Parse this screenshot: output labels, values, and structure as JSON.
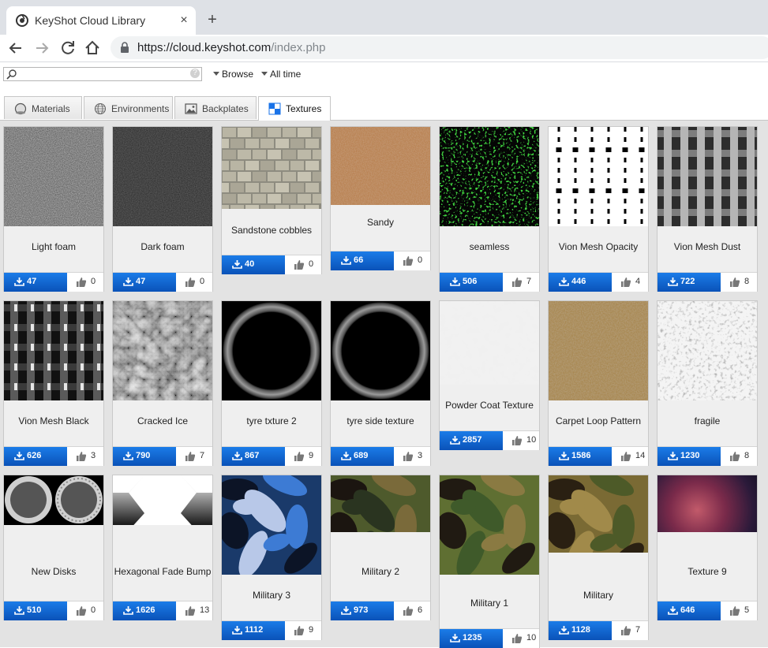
{
  "browser": {
    "tab_title": "KeyShot Cloud Library",
    "tab_close": "×",
    "new_tab": "+",
    "url_host": "https://cloud.keyshot.com",
    "url_path": "/index.php"
  },
  "filters": {
    "search_placeholder": "",
    "help": "?",
    "browse": "Browse",
    "time": "All time"
  },
  "tabs": [
    {
      "label": "Materials",
      "icon": "globe-outline-icon"
    },
    {
      "label": "Environments",
      "icon": "grid-globe-icon"
    },
    {
      "label": "Backplates",
      "icon": "image-icon"
    },
    {
      "label": "Textures",
      "icon": "checker-icon",
      "active": true
    }
  ],
  "colors": {
    "download_button": "#0a52b8",
    "accent": "#1b7ce8"
  },
  "items": [
    {
      "title": "Light foam",
      "downloads": "47",
      "likes": "0",
      "texture": "light-foam"
    },
    {
      "title": "Dark foam",
      "downloads": "47",
      "likes": "0",
      "texture": "dark-foam"
    },
    {
      "title": "Sandstone cobbles",
      "downloads": "40",
      "likes": "0",
      "texture": "sandstone"
    },
    {
      "title": "Sandy",
      "downloads": "66",
      "likes": "0",
      "texture": "sandy"
    },
    {
      "title": "seamless",
      "downloads": "506",
      "likes": "7",
      "texture": "green-speckle"
    },
    {
      "title": "Vion Mesh Opacity",
      "downloads": "446",
      "likes": "4",
      "texture": "mesh-opacity"
    },
    {
      "title": "Vion Mesh Dust",
      "downloads": "722",
      "likes": "8",
      "texture": "mesh-dust"
    },
    {
      "title": "Vion Mesh Black",
      "downloads": "626",
      "likes": "3",
      "texture": "mesh-black"
    },
    {
      "title": "Cracked Ice",
      "downloads": "790",
      "likes": "7",
      "texture": "cracked-ice"
    },
    {
      "title": "tyre txture 2",
      "downloads": "867",
      "likes": "9",
      "texture": "tyre"
    },
    {
      "title": "tyre side texture",
      "downloads": "689",
      "likes": "3",
      "texture": "tyre"
    },
    {
      "title": "Powder Coat Texture",
      "downloads": "2857",
      "likes": "10",
      "texture": "powder-coat"
    },
    {
      "title": "Carpet Loop Pattern",
      "downloads": "1586",
      "likes": "14",
      "texture": "carpet"
    },
    {
      "title": "fragile",
      "downloads": "1230",
      "likes": "8",
      "texture": "fragile"
    },
    {
      "title": "New Disks",
      "downloads": "510",
      "likes": "0",
      "texture": "disks"
    },
    {
      "title": "Hexagonal Fade Bump",
      "downloads": "1626",
      "likes": "13",
      "texture": "hex-fade"
    },
    {
      "title": "Military 3",
      "downloads": "1112",
      "likes": "9",
      "texture": "camo-blue"
    },
    {
      "title": "Military 2",
      "downloads": "973",
      "likes": "6",
      "texture": "camo-dark"
    },
    {
      "title": "Military 1",
      "downloads": "1235",
      "likes": "10",
      "texture": "camo-green"
    },
    {
      "title": "Military",
      "downloads": "1128",
      "likes": "7",
      "texture": "camo-brown"
    },
    {
      "title": "Texture 9",
      "downloads": "646",
      "likes": "5",
      "texture": "nebula"
    }
  ]
}
